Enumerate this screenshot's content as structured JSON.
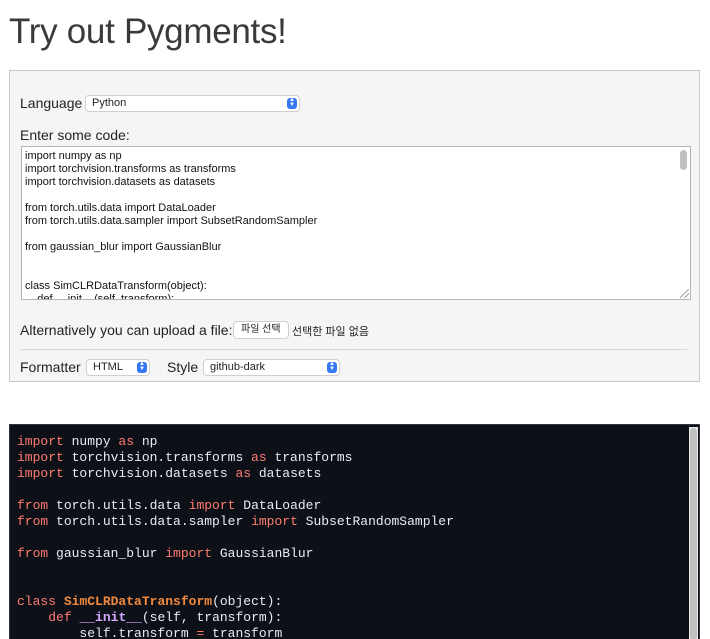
{
  "page": {
    "title": "Try out Pygments!"
  },
  "form": {
    "language_label": "Language",
    "language_value": "Python",
    "code_label": "Enter some code:",
    "code_lines": [
      "import numpy as np",
      "import torchvision.transforms as transforms",
      "import torchvision.datasets as datasets",
      "",
      "from torch.utils.data import DataLoader",
      "from torch.utils.data.sampler import SubsetRandomSampler",
      "",
      "from gaussian_blur import GaussianBlur",
      "",
      "",
      "class SimCLRDataTransform(object):",
      "    def __init__(self, transform):"
    ],
    "upload_label": "Alternatively you can upload a file:",
    "file_button": "파일 선택",
    "file_status": "선택한 파일 없음",
    "formatter_label": "Formatter",
    "formatter_value": "HTML",
    "style_label": "Style",
    "style_value": "github-dark"
  },
  "output": {
    "theme": "github-dark",
    "colors": {
      "background": "#0d1117",
      "keyword": "#ff7b72",
      "class_name": "#f0883e",
      "function_name": "#d2a8ff",
      "text": "#e6edf3"
    },
    "lines": [
      {
        "tokens": [
          {
            "t": "import",
            "c": "kw"
          },
          {
            "t": " numpy ",
            "c": ""
          },
          {
            "t": "as",
            "c": "kw"
          },
          {
            "t": " np",
            "c": ""
          }
        ]
      },
      {
        "tokens": [
          {
            "t": "import",
            "c": "kw"
          },
          {
            "t": " torchvision.transforms ",
            "c": ""
          },
          {
            "t": "as",
            "c": "kw"
          },
          {
            "t": " transforms",
            "c": ""
          }
        ]
      },
      {
        "tokens": [
          {
            "t": "import",
            "c": "kw"
          },
          {
            "t": " torchvision.datasets ",
            "c": ""
          },
          {
            "t": "as",
            "c": "kw"
          },
          {
            "t": " datasets",
            "c": ""
          }
        ]
      },
      {
        "tokens": []
      },
      {
        "tokens": [
          {
            "t": "from",
            "c": "kw"
          },
          {
            "t": " torch.utils.data ",
            "c": ""
          },
          {
            "t": "import",
            "c": "kw"
          },
          {
            "t": " DataLoader",
            "c": ""
          }
        ]
      },
      {
        "tokens": [
          {
            "t": "from",
            "c": "kw"
          },
          {
            "t": " torch.utils.data.sampler ",
            "c": ""
          },
          {
            "t": "import",
            "c": "kw"
          },
          {
            "t": " SubsetRandomSampler",
            "c": ""
          }
        ]
      },
      {
        "tokens": []
      },
      {
        "tokens": [
          {
            "t": "from",
            "c": "kw"
          },
          {
            "t": " gaussian_blur ",
            "c": ""
          },
          {
            "t": "import",
            "c": "kw"
          },
          {
            "t": " GaussianBlur",
            "c": ""
          }
        ]
      },
      {
        "tokens": []
      },
      {
        "tokens": []
      },
      {
        "tokens": [
          {
            "t": "class",
            "c": "kw"
          },
          {
            "t": " ",
            "c": ""
          },
          {
            "t": "SimCLRDataTransform",
            "c": "cls"
          },
          {
            "t": "(object):",
            "c": ""
          }
        ]
      },
      {
        "tokens": [
          {
            "t": "    ",
            "c": ""
          },
          {
            "t": "def",
            "c": "kw"
          },
          {
            "t": " ",
            "c": ""
          },
          {
            "t": "__init__",
            "c": "fn"
          },
          {
            "t": "(self, transform):",
            "c": ""
          }
        ]
      },
      {
        "tokens": [
          {
            "t": "        self.transform ",
            "c": ""
          },
          {
            "t": "=",
            "c": "kw"
          },
          {
            "t": " transform",
            "c": ""
          }
        ]
      }
    ]
  }
}
